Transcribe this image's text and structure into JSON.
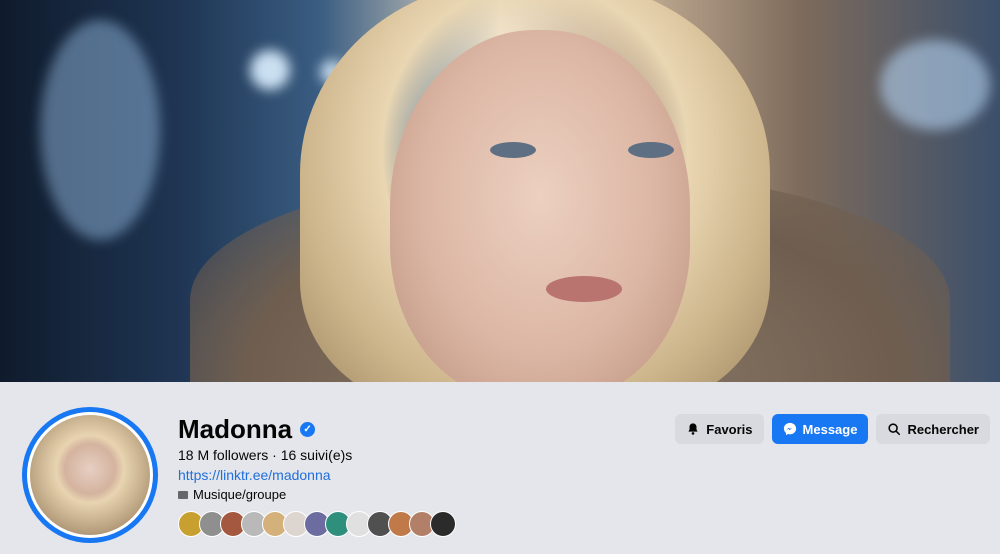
{
  "profile": {
    "name": "Madonna",
    "stats": "18 M followers · 16 suivi(e)s",
    "link": "https://linktr.ee/madonna",
    "category": "Musique/groupe"
  },
  "actions": {
    "favorites_label": "Favoris",
    "message_label": "Message",
    "search_label": "Rechercher"
  },
  "icons": {
    "verified": "verified-badge-icon",
    "bell": "bell-icon",
    "messenger": "messenger-icon",
    "search": "search-icon",
    "category": "category-icon"
  },
  "colors": {
    "accent": "#1877f2",
    "background": "#e4e6eb",
    "button_secondary": "#d8dadf",
    "link": "#216fdb"
  },
  "followers_preview": [
    {
      "color": "#c8a030"
    },
    {
      "color": "#8f8f8f"
    },
    {
      "color": "#a4583f"
    },
    {
      "color": "#b9b9b9"
    },
    {
      "color": "#d4b07b"
    },
    {
      "color": "#dcd5d0"
    },
    {
      "color": "#6c6ca0"
    },
    {
      "color": "#2f8f7d"
    },
    {
      "color": "#e0e0e0"
    },
    {
      "color": "#505050"
    },
    {
      "color": "#c07a4a"
    },
    {
      "color": "#b27f68"
    },
    {
      "color": "#2b2b2b"
    }
  ]
}
